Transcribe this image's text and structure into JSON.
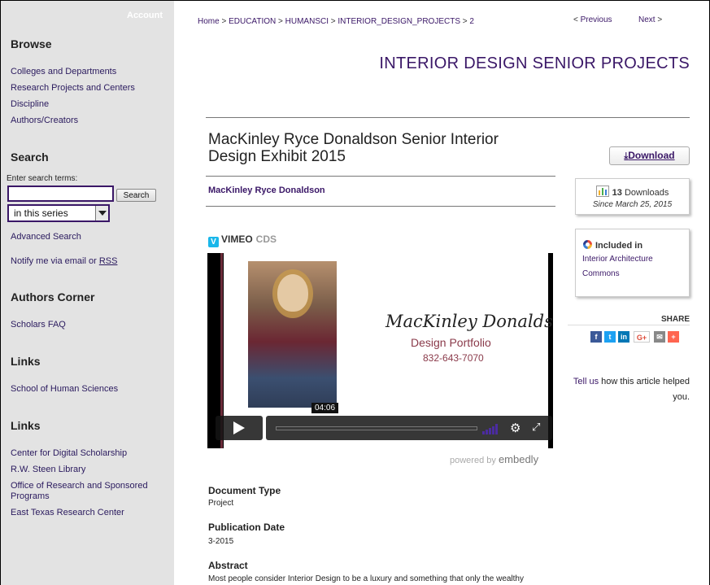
{
  "sidebar": {
    "account": "Account",
    "browse": {
      "heading": "Browse",
      "items": [
        "Colleges and Departments",
        "Research Projects and Centers",
        "Discipline",
        "Authors/Creators"
      ]
    },
    "search": {
      "heading": "Search",
      "label": "Enter search terms:",
      "input_value": "",
      "button": "Search",
      "scope": "in this series",
      "advanced": "Advanced Search",
      "notify_prefix": "Notify me via email or ",
      "notify_rss": "RSS"
    },
    "authors_corner": {
      "heading": "Authors Corner",
      "items": [
        "Scholars FAQ"
      ]
    },
    "links1": {
      "heading": "Links",
      "items": [
        "School of Human Sciences"
      ]
    },
    "links2": {
      "heading": "Links",
      "items": [
        "Center for Digital Scholarship",
        "R.W. Steen Library",
        "Office of Research and Sponsored Programs",
        "East Texas Research Center"
      ]
    }
  },
  "breadcrumb": {
    "items": [
      "Home",
      "EDUCATION",
      "HUMANSCI",
      "INTERIOR_DESIGN_PROJECTS",
      "2"
    ],
    "separator": ">"
  },
  "pager": {
    "prev": "< Previous",
    "prev_label": "Previous",
    "next_label": "Next",
    "next_suffix": ">"
  },
  "series_title": "INTERIOR DESIGN SENIOR PROJECTS",
  "article": {
    "title": "MacKinley Ryce Donaldson Senior Interior Design Exhibit 2015",
    "author": "MacKinley Ryce Donaldson"
  },
  "video": {
    "provider_badge": "V",
    "provider": "VIMEO",
    "provider_extra": "CDS",
    "card_name": "MacKinley Donaldson",
    "card_subtitle": "Design Portfolio",
    "card_phone": "832-643-7070",
    "time": "04:06",
    "powered_by": "powered by",
    "embedly": "embedly"
  },
  "metadata": {
    "doc_type_label": "Document Type",
    "doc_type": "Project",
    "pub_date_label": "Publication Date",
    "pub_date": "3-2015",
    "abstract_label": "Abstract",
    "abstract": "Most people consider Interior Design to be a luxury and something that only the wealthy"
  },
  "right": {
    "download": "Download",
    "downloads_count": "13",
    "downloads_word": "Downloads",
    "since": "Since March 25, 2015",
    "included_in": "Included in",
    "included_link_1": "Interior Architecture",
    "included_link_2": "Commons",
    "share": "SHARE",
    "share_icons": {
      "facebook": "f",
      "twitter": "t",
      "linkedin": "in",
      "google": "G+",
      "email": "✉",
      "more": "+"
    },
    "tell_us_link": "Tell us",
    "tell_us_rest": " how this article helped you."
  },
  "colors": {
    "accent": "#3a1767",
    "sidebar_bg": "#e3e3e3",
    "facebook": "#3b5998",
    "twitter": "#1da1f2",
    "linkedin": "#0077b5",
    "google": "#dd4b39",
    "email": "#888888",
    "more": "#ff6550"
  }
}
